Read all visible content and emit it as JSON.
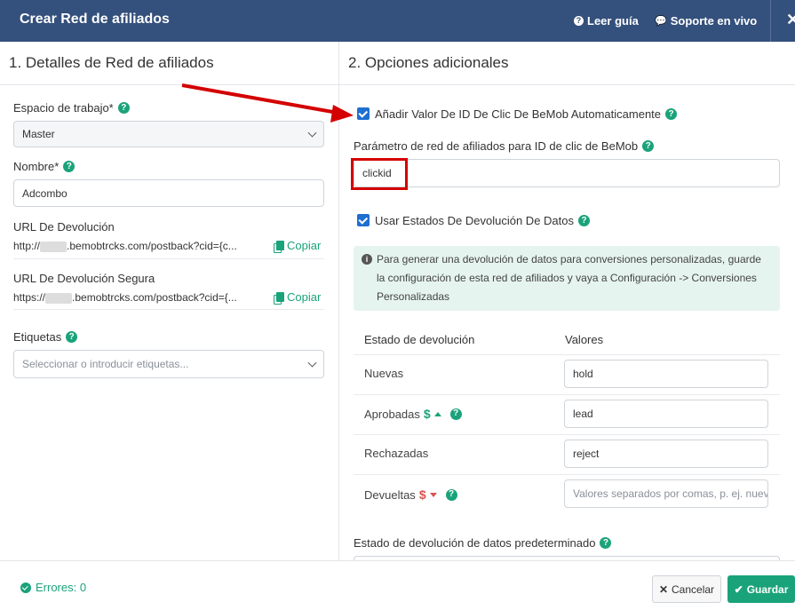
{
  "header": {
    "title": "Crear Red de afiliados",
    "guide_link": "Leer guía",
    "support_link": "Soporte en vivo",
    "close_glyph": "✕"
  },
  "left": {
    "section_title": "1. Detalles de Red de afiliados",
    "workspace_label": "Espacio de trabajo*",
    "workspace_value": "Master",
    "name_label": "Nombre*",
    "name_value": "Adcombo",
    "postback_label": "URL De Devolución",
    "postback_prefix": "http://",
    "postback_suffix": ".bemobtrcks.com/postback?cid={c...",
    "secure_postback_label": "URL De Devolución Segura",
    "secure_postback_prefix": "https://",
    "secure_postback_suffix": ".bemobtrcks.com/postback?cid={...",
    "copy_label": "Copiar",
    "tags_label": "Etiquetas",
    "tags_placeholder": "Seleccionar o introducir etiquetas..."
  },
  "right": {
    "section_title": "2. Opciones adicionales",
    "append_click_id_label": "Añadir Valor De ID De Clic De BeMob Automaticamente",
    "param_label": "Parámetro de red de afiliados para ID de clic de BeMob",
    "param_value": "clickid",
    "use_statuses_label": "Usar Estados De Devolución De Datos",
    "info_text": "Para generar una devolución de datos para conversiones personalizadas, guarde la configuración de esta red de afiliados y vaya a Configuración -> Conversiones Personalizadas",
    "table": {
      "col_status": "Estado de devolución",
      "col_values": "Valores",
      "rows": [
        {
          "label": "Nuevas",
          "value": "hold"
        },
        {
          "label": "Aprobadas",
          "value": "lead"
        },
        {
          "label": "Rechazadas",
          "value": "reject"
        },
        {
          "label": "Devueltas",
          "value": "",
          "placeholder": "Valores separados por comas, p. ej. nuevo"
        }
      ]
    },
    "default_status_label": "Estado de devolución de datos predeterminado"
  },
  "footer": {
    "errors": "Errores: 0",
    "cancel": "Cancelar",
    "save": "Guardar"
  },
  "colors": {
    "header_bg": "#34507c",
    "accent_green": "#1aa37a",
    "checkbox_blue": "#1f6fd1",
    "annotation_red": "#d40000"
  }
}
